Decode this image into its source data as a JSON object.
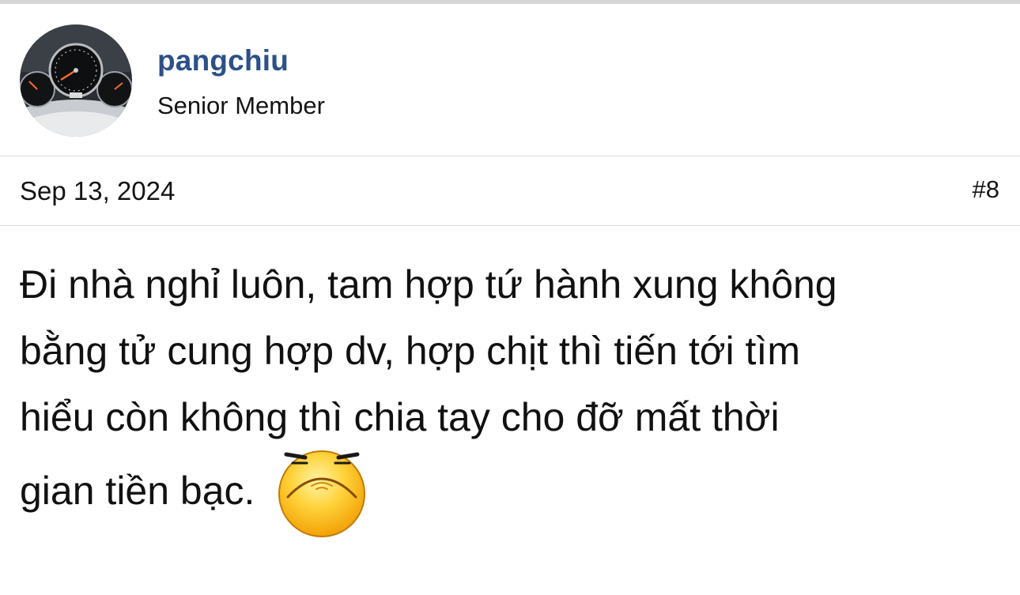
{
  "author": {
    "username": "pangchiu",
    "title": "Senior Member",
    "avatar_icon": "car-dashboard-avatar"
  },
  "post": {
    "date": "Sep 13, 2024",
    "number": "#8",
    "lines": [
      "Đi nhà nghỉ luôn, tam hợp tứ hành xung không",
      "bằng tử cung hợp dv, hợp chịt thì tiến tới tìm",
      "hiểu còn không thì chia tay cho đỡ mất thời",
      "gian tiền bạc."
    ],
    "emoji_icon": "grumpy-face-emoji-icon"
  },
  "colors": {
    "username": "#2c5088",
    "text": "#141414",
    "divider": "#dcdcdc",
    "emoji_face": "#f7b500"
  }
}
